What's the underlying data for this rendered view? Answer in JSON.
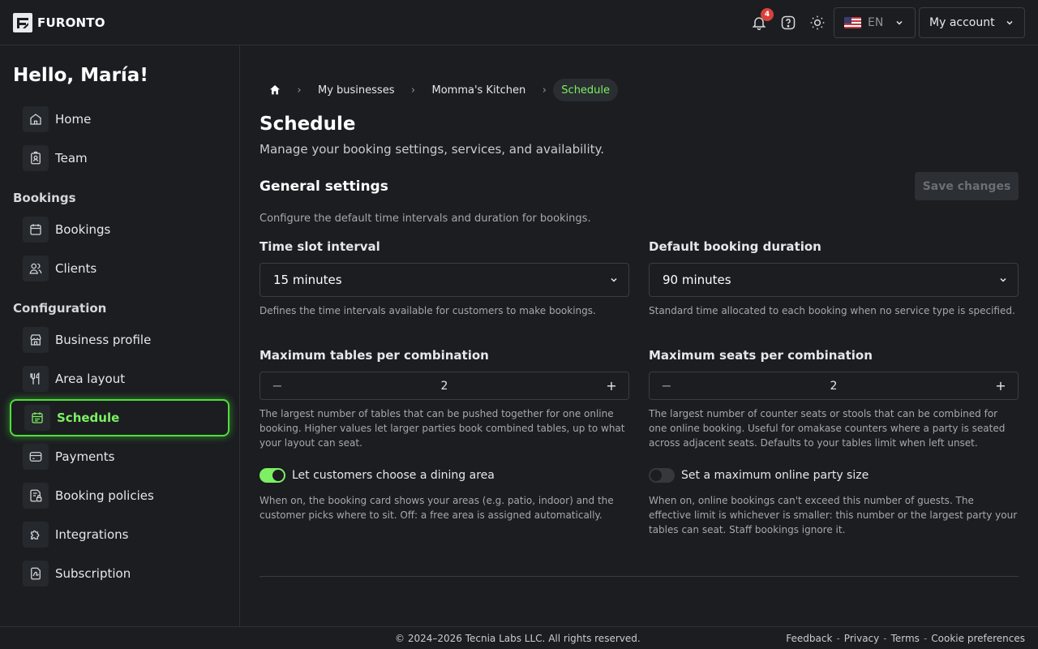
{
  "brand": {
    "name": "FURONTO"
  },
  "topbar": {
    "notification_count": "4",
    "language": "EN",
    "account_label": "My account"
  },
  "sidebar": {
    "greeting": "Hello, María!",
    "items": [
      {
        "label": "Home",
        "icon": "home-icon"
      },
      {
        "label": "Team",
        "icon": "badge-icon"
      }
    ],
    "bookings_heading": "Bookings",
    "booking_items": [
      {
        "label": "Bookings",
        "icon": "calendar-icon"
      },
      {
        "label": "Clients",
        "icon": "users-icon"
      }
    ],
    "configuration_heading": "Configuration",
    "config_items": [
      {
        "label": "Business profile",
        "icon": "store-icon"
      },
      {
        "label": "Area layout",
        "icon": "utensils-icon"
      },
      {
        "label": "Schedule",
        "icon": "calendar-check-icon",
        "active": true
      },
      {
        "label": "Payments",
        "icon": "card-icon"
      },
      {
        "label": "Booking policies",
        "icon": "policy-icon"
      },
      {
        "label": "Integrations",
        "icon": "puzzle-icon"
      },
      {
        "label": "Subscription",
        "icon": "subscription-icon"
      }
    ]
  },
  "breadcrumb": {
    "items": [
      "My businesses",
      "Momma's Kitchen"
    ],
    "current": "Schedule"
  },
  "page": {
    "title": "Schedule",
    "subtitle": "Manage your booking settings, services, and availability."
  },
  "general": {
    "title": "General settings",
    "save_label": "Save changes",
    "description": "Configure the default time intervals and duration for bookings.",
    "time_slot": {
      "label": "Time slot interval",
      "value": "15 minutes",
      "help": "Defines the time intervals available for customers to make bookings."
    },
    "duration": {
      "label": "Default booking duration",
      "value": "90 minutes",
      "help": "Standard time allocated to each booking when no service type is specified."
    },
    "max_tables": {
      "label": "Maximum tables per combination",
      "value": "2",
      "help": "The largest number of tables that can be pushed together for one online booking. Higher values let larger parties book combined tables, up to what your layout can seat."
    },
    "max_seats": {
      "label": "Maximum seats per combination",
      "value": "2",
      "help": "The largest number of counter seats or stools that can be combined for one online booking. Useful for omakase counters where a party is seated across adjacent seats. Defaults to your tables limit when left unset."
    },
    "dining_area": {
      "label": "Let customers choose a dining area",
      "enabled": true,
      "help": "When on, the booking card shows your areas (e.g. patio, indoor) and the customer picks where to sit. Off: a free area is assigned automatically."
    },
    "party_size": {
      "label": "Set a maximum online party size",
      "enabled": false,
      "help": "When on, online bookings can't exceed this number of guests. The effective limit is whichever is smaller: this number or the largest party your tables can seat. Staff bookings ignore it."
    }
  },
  "footer": {
    "copyright": "© 2024–2026 Tecnia Labs LLC. All rights reserved.",
    "links": [
      "Feedback",
      "Privacy",
      "Terms",
      "Cookie preferences"
    ]
  },
  "colors": {
    "accent": "#7cf062",
    "background": "#1b1d20",
    "badge": "#d8413b"
  }
}
